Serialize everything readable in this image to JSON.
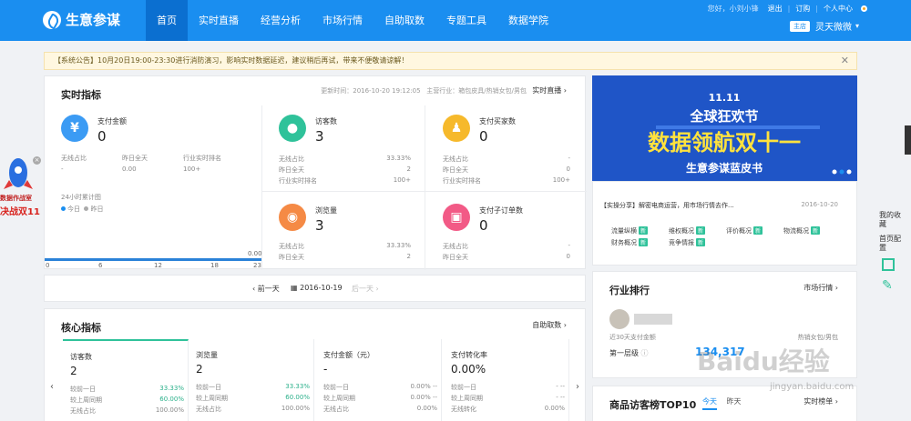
{
  "brand": {
    "name": "生意参谋"
  },
  "nav": [
    "首页",
    "实时直播",
    "经营分析",
    "市场行情",
    "自助取数",
    "专题工具",
    "数据学院"
  ],
  "top_right": {
    "greeting": "您好，小刘小锋",
    "logout": "退出",
    "order": "订购",
    "personal": "个人中心",
    "shop_tag": "主店",
    "shop_name": "灵天微微"
  },
  "notice": {
    "text": "【系统公告】10月20日19:00-23:30进行消防演习，影响实时数据延迟，建议稍后再试，带来不便敬请谅解！",
    "close": "✕"
  },
  "realtime": {
    "title": "实时指标",
    "updated": "更新时间：2016-10-20 19:12:05",
    "industry": "主营行业：箱包皮具/热销女包/男包",
    "live_link": "实时直播",
    "pay": {
      "title": "支付金额",
      "value": "0",
      "k1": "无线占比",
      "v1": "-",
      "k2": "昨日全天",
      "v2": "0.00",
      "k3": "行业实时排名",
      "v3": "100+"
    },
    "chart_label": "24小时累计图",
    "legend_today": "今日",
    "legend_yesterday": "昨日",
    "visitors": {
      "title": "访客数",
      "value": "3",
      "k1": "无线占比",
      "v1": "33.33%",
      "k2": "昨日全天",
      "v2": "2",
      "k3": "行业实时排名",
      "v3": "100+"
    },
    "buyers": {
      "title": "支付买家数",
      "value": "0",
      "k1": "无线占比",
      "v1": "-",
      "k2": "昨日全天",
      "v2": "0",
      "k3": "行业实时排名",
      "v3": "100+"
    },
    "pageviews": {
      "title": "浏览量",
      "value": "3",
      "k1": "无线占比",
      "v1": "33.33%",
      "k2": "昨日全天",
      "v2": "2"
    },
    "suborders": {
      "title": "支付子订单数",
      "value": "0",
      "k1": "无线占比",
      "v1": "-",
      "k2": "昨日全天",
      "v2": "0"
    }
  },
  "chart_data": {
    "type": "line",
    "title": "24小时累计图",
    "x_ticks": [
      "0",
      "6",
      "12",
      "18",
      "23"
    ],
    "y_ticks": [
      "0.00"
    ],
    "series": [
      {
        "name": "今日",
        "values": []
      },
      {
        "name": "昨日",
        "values": []
      }
    ]
  },
  "datebar": {
    "prev": "前一天",
    "date": "2016-10-19",
    "next": "后一天"
  },
  "core": {
    "title": "核心指标",
    "more": "自助取数",
    "cards": [
      {
        "title": "访客数",
        "value": "2",
        "r1k": "较前一日",
        "r1v": "33.33%",
        "r2k": "较上周同期",
        "r2v": "60.00%",
        "r3k": "无线占比",
        "r3v": "100.00%"
      },
      {
        "title": "浏览量",
        "value": "2",
        "r1k": "较前一日",
        "r1v": "33.33%",
        "r2k": "较上周同期",
        "r2v": "60.00%",
        "r3k": "无线占比",
        "r3v": "100.00%"
      },
      {
        "title": "支付金额（元）",
        "value": "-",
        "r1k": "较前一日",
        "r1v": "0.00% --",
        "r2k": "较上周同期",
        "r2v": "0.00% --",
        "r3k": "无线占比",
        "r3v": "0.00%"
      },
      {
        "title": "支付转化率",
        "value": "0.00%",
        "r1k": "较前一日",
        "r1v": "- --",
        "r2k": "较上周同期",
        "r2v": "- --",
        "r3k": "无线转化",
        "r3v": "0.00%"
      }
    ]
  },
  "banner": {
    "tag": "11.11",
    "line1": "全球狂欢节",
    "line2": "数据领航双十一",
    "line3": "生意参谋蓝皮书"
  },
  "news": {
    "headline": "【实操分享】解密电商运营，用市场行情去作...",
    "date": "2016-10-20",
    "tags": [
      "流量纵横",
      "维权概况",
      "评价概况",
      "物流概况",
      "财务概况",
      "竞争情报"
    ],
    "new": "新"
  },
  "industry_rank": {
    "title": "行业排行",
    "more": "市场行情",
    "sub": "近30天支付金额",
    "rank": "第一层级",
    "number": "134,317",
    "category": "热销女包/男包"
  },
  "top10": {
    "title": "商品访客榜TOP10",
    "tab_today": "今天",
    "tab_week": "昨天",
    "more": "实时榜单"
  },
  "rocket": {
    "line1": "数据作战室",
    "line2": "决战双11"
  },
  "side": {
    "fav": "我的收藏",
    "home": "首页配置"
  },
  "watermark": {
    "brand": "Baidu经验",
    "url": "jingyan.baidu.com"
  },
  "colors": {
    "primary": "#1a8ef0",
    "green": "#2fc29a",
    "orange": "#f58a45",
    "pink": "#f25a86",
    "yellow": "#f6b92b",
    "banner": "#1f55c7"
  }
}
